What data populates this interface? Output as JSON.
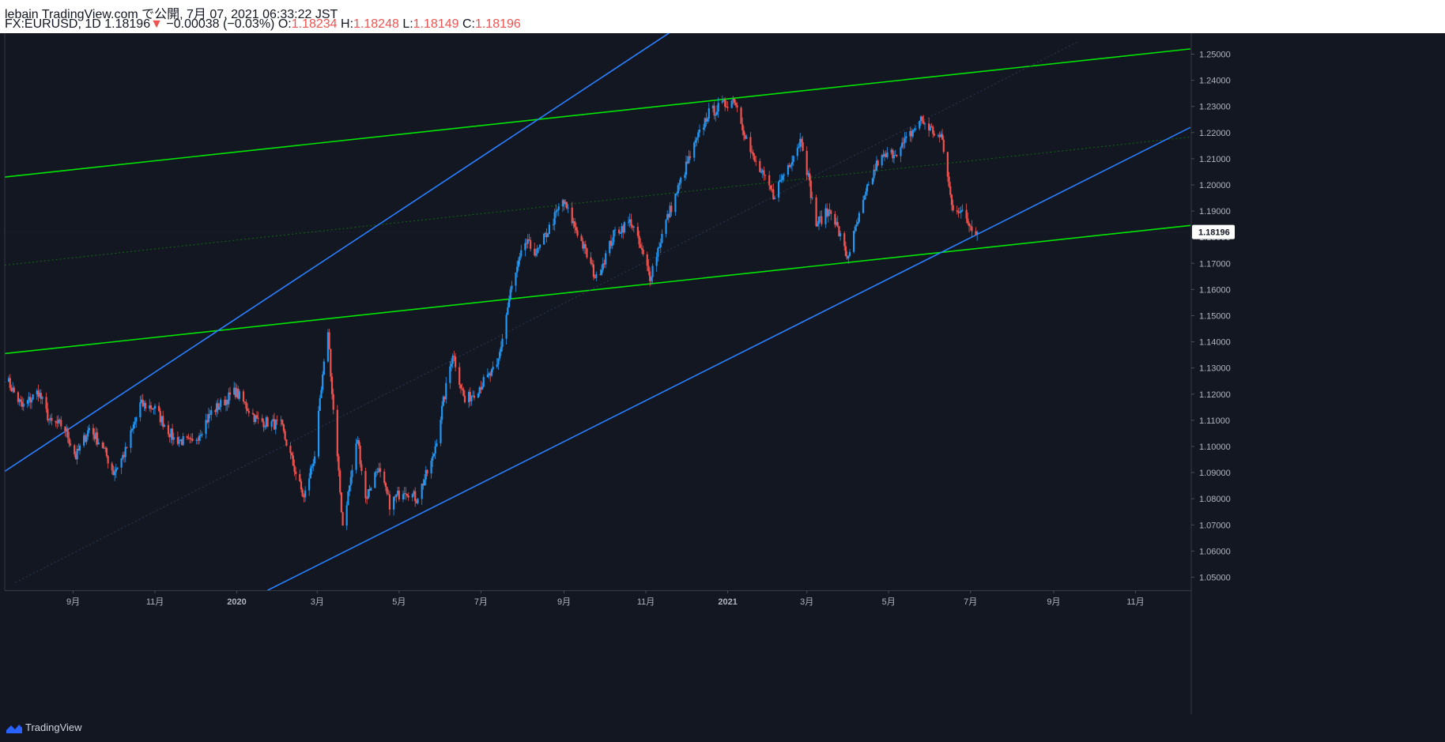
{
  "header": {
    "line1": "lebain TradingView.com で公開, 7月 07, 2021 06:33:22 JST",
    "symbol": "FX:EURUSD, 1D",
    "price": "1.18196",
    "arrow": "▼",
    "change": "−0.00038 (−0.03%)",
    "o_label": "O:",
    "o_value": "1.18234",
    "h_label": "H:",
    "h_value": "1.18248",
    "l_label": "L:",
    "l_value": "1.18149",
    "c_label": "C:",
    "c_value": "1.18196"
  },
  "footer": {
    "brand": "TradingView"
  },
  "colors": {
    "background": "#131722",
    "up": "#2196f3",
    "down": "#ef5350",
    "green_channel": "#00e600",
    "blue_channel": "#2a7fff"
  },
  "chart_data": {
    "type": "candlestick",
    "symbol": "FX:EURUSD",
    "interval": "1D",
    "ylim": [
      1.045,
      1.258
    ],
    "xlim": [
      "2019-07-12",
      "2021-12-12"
    ],
    "y_ticks": [
      "1.05000",
      "1.06000",
      "1.07000",
      "1.08000",
      "1.09000",
      "1.10000",
      "1.11000",
      "1.12000",
      "1.13000",
      "1.14000",
      "1.15000",
      "1.16000",
      "1.17000",
      "1.18000",
      "1.19000",
      "1.20000",
      "1.21000",
      "1.22000",
      "1.23000",
      "1.24000",
      "1.25000"
    ],
    "x_ticks": [
      {
        "label": "9月",
        "date": "2019-09-01",
        "bold": false
      },
      {
        "label": "11月",
        "date": "2019-11-01",
        "bold": false
      },
      {
        "label": "2020",
        "date": "2020-01-01",
        "bold": true
      },
      {
        "label": "3月",
        "date": "2020-03-01",
        "bold": false
      },
      {
        "label": "5月",
        "date": "2020-05-01",
        "bold": false
      },
      {
        "label": "7月",
        "date": "2020-07-01",
        "bold": false
      },
      {
        "label": "9月",
        "date": "2020-09-01",
        "bold": false
      },
      {
        "label": "11月",
        "date": "2020-11-01",
        "bold": false
      },
      {
        "label": "2021",
        "date": "2021-01-01",
        "bold": true
      },
      {
        "label": "3月",
        "date": "2021-03-01",
        "bold": false
      },
      {
        "label": "5月",
        "date": "2021-05-01",
        "bold": false
      },
      {
        "label": "7月",
        "date": "2021-07-01",
        "bold": false
      },
      {
        "label": "9月",
        "date": "2021-09-01",
        "bold": false
      },
      {
        "label": "11月",
        "date": "2021-11-01",
        "bold": false
      }
    ],
    "last_price": "1.18196",
    "last_price_value": 1.18196,
    "price_path": [
      [
        "2019-07-12",
        1.127
      ],
      [
        "2019-07-25",
        1.115
      ],
      [
        "2019-08-06",
        1.121
      ],
      [
        "2019-08-15",
        1.109
      ],
      [
        "2019-08-25",
        1.108
      ],
      [
        "2019-09-03",
        1.096
      ],
      [
        "2019-09-13",
        1.107
      ],
      [
        "2019-09-23",
        1.1
      ],
      [
        "2019-10-01",
        1.09
      ],
      [
        "2019-10-10",
        1.098
      ],
      [
        "2019-10-21",
        1.116
      ],
      [
        "2019-10-31",
        1.115
      ],
      [
        "2019-11-15",
        1.103
      ],
      [
        "2019-11-29",
        1.101
      ],
      [
        "2019-12-13",
        1.113
      ],
      [
        "2019-12-31",
        1.121
      ],
      [
        "2020-01-16",
        1.11
      ],
      [
        "2020-02-03",
        1.108
      ],
      [
        "2020-02-20",
        1.08
      ],
      [
        "2020-02-28",
        1.097
      ],
      [
        "2020-03-09",
        1.145
      ],
      [
        "2020-03-12",
        1.12
      ],
      [
        "2020-03-20",
        1.07
      ],
      [
        "2020-03-31",
        1.103
      ],
      [
        "2020-04-06",
        1.08
      ],
      [
        "2020-04-15",
        1.092
      ],
      [
        "2020-04-24",
        1.078
      ],
      [
        "2020-05-05",
        1.084
      ],
      [
        "2020-05-14",
        1.08
      ],
      [
        "2020-05-26",
        1.095
      ],
      [
        "2020-06-10",
        1.136
      ],
      [
        "2020-06-19",
        1.117
      ],
      [
        "2020-06-30",
        1.123
      ],
      [
        "2020-07-13",
        1.13
      ],
      [
        "2020-07-23",
        1.159
      ],
      [
        "2020-08-03",
        1.178
      ],
      [
        "2020-08-12",
        1.174
      ],
      [
        "2020-08-31",
        1.194
      ],
      [
        "2020-09-11",
        1.182
      ],
      [
        "2020-09-25",
        1.164
      ],
      [
        "2020-10-09",
        1.182
      ],
      [
        "2020-10-21",
        1.186
      ],
      [
        "2020-11-04",
        1.165
      ],
      [
        "2020-11-16",
        1.186
      ],
      [
        "2020-12-01",
        1.207
      ],
      [
        "2020-12-17",
        1.227
      ],
      [
        "2021-01-06",
        1.233
      ],
      [
        "2021-01-19",
        1.211
      ],
      [
        "2021-02-04",
        1.196
      ],
      [
        "2021-02-25",
        1.218
      ],
      [
        "2021-03-08",
        1.185
      ],
      [
        "2021-03-19",
        1.191
      ],
      [
        "2021-03-31",
        1.172
      ],
      [
        "2021-04-15",
        1.198
      ],
      [
        "2021-04-23",
        1.209
      ],
      [
        "2021-05-10",
        1.214
      ],
      [
        "2021-05-25",
        1.225
      ],
      [
        "2021-06-10",
        1.217
      ],
      [
        "2021-06-17",
        1.192
      ],
      [
        "2021-06-22",
        1.191
      ],
      [
        "2021-06-30",
        1.185
      ],
      [
        "2021-07-06",
        1.182
      ]
    ],
    "trendlines": [
      {
        "name": "green-upper",
        "style": "solid",
        "color": "#00e600",
        "p1": [
          "2019-07-12",
          1.203
        ],
        "p2": [
          "2021-12-12",
          1.252
        ]
      },
      {
        "name": "green-lower",
        "style": "solid",
        "color": "#00e600",
        "p1": [
          "2019-07-12",
          1.1355
        ],
        "p2": [
          "2021-12-12",
          1.1845
        ]
      },
      {
        "name": "green-mid",
        "style": "dotted",
        "color": "#0f6b0f",
        "p1": [
          "2019-07-12",
          1.1693
        ],
        "p2": [
          "2021-12-12",
          1.2183
        ]
      },
      {
        "name": "blue-upper",
        "style": "solid",
        "color": "#2a7fff",
        "p1": [
          "2019-07-12",
          1.0905
        ],
        "p2": [
          "2020-11-24",
          1.26
        ]
      },
      {
        "name": "blue-lower",
        "style": "solid",
        "color": "#2a7fff",
        "p1": [
          "2020-01-24",
          1.045
        ],
        "p2": [
          "2021-12-12",
          1.222
        ]
      },
      {
        "name": "blue-mid",
        "style": "dotted",
        "color": "#2a3a55",
        "p1": [
          "2019-07-20",
          1.048
        ],
        "p2": [
          "2021-09-20",
          1.255
        ]
      }
    ]
  }
}
